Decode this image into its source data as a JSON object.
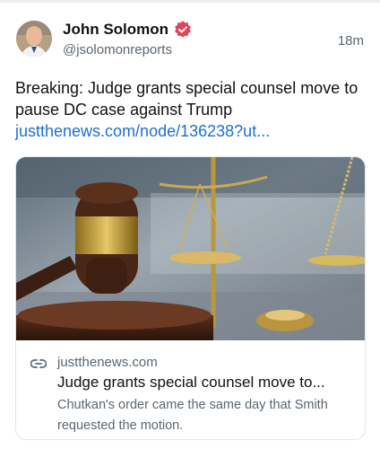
{
  "author": {
    "name": "John Solomon",
    "handle": "@jsolomonreports",
    "verified_color": "#e0455b"
  },
  "post": {
    "time": "18m",
    "text": "Breaking: Judge grants special counsel move to pause DC case against Trump",
    "link": "justthenews.com/node/136238?ut..."
  },
  "link_card": {
    "domain": "justthenews.com",
    "title": "Judge grants special counsel move to...",
    "description": "Chutkan's order came the same day that Smith requested the motion.",
    "image_alt": "gavel-and-scales-photo"
  },
  "colors": {
    "link": "#1d6fd1",
    "muted": "#5b6670"
  }
}
